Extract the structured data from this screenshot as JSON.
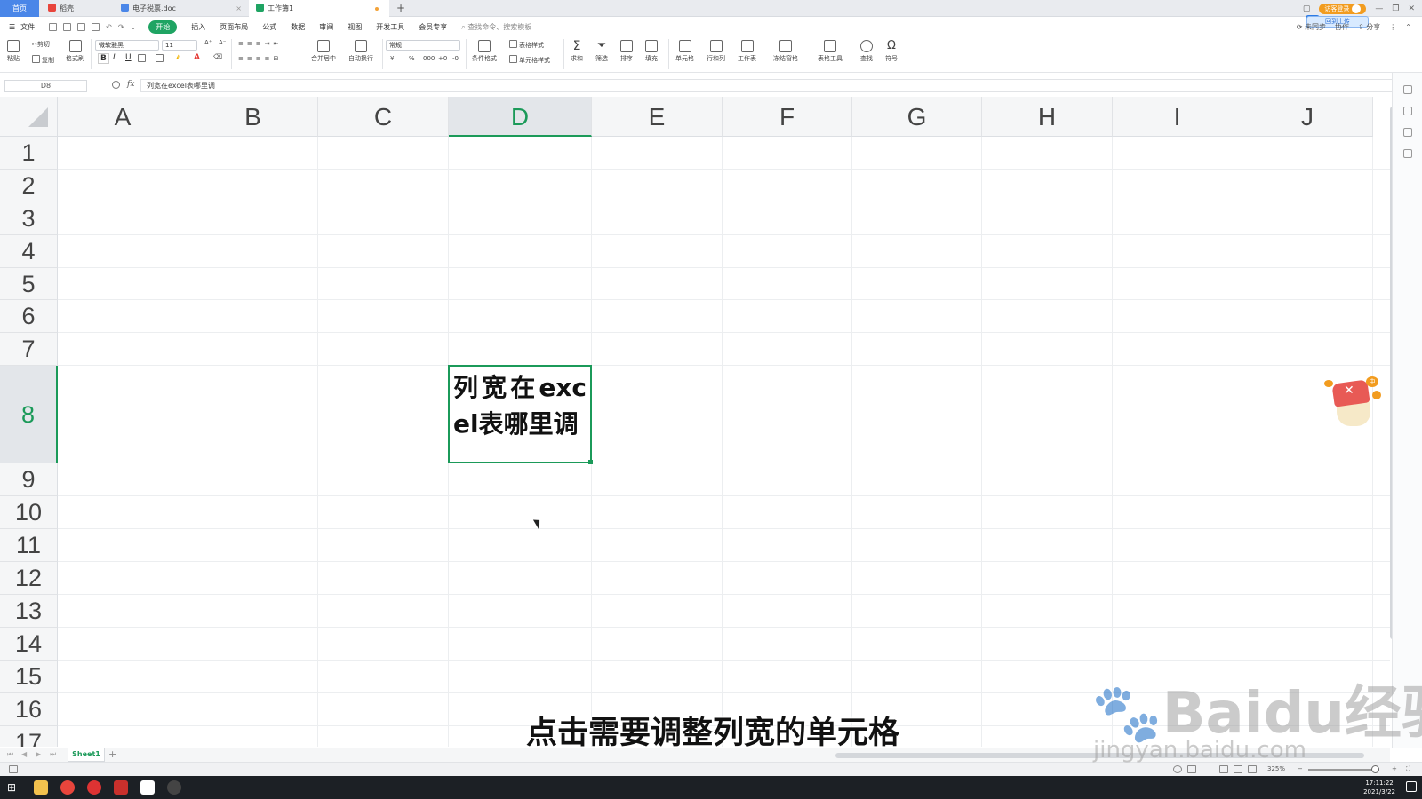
{
  "tabs": {
    "home": "首页",
    "items": [
      {
        "label": "稻壳",
        "color": "#e8453c"
      },
      {
        "label": "电子税票.doc",
        "color": "#4a86e8"
      },
      {
        "label": "工作簿1",
        "color": "#1fa463"
      }
    ],
    "add": "+",
    "login": "访客登录",
    "upload": "回到上传"
  },
  "menu": {
    "file": "文件",
    "items": [
      "开始",
      "插入",
      "页面布局",
      "公式",
      "数据",
      "审阅",
      "视图",
      "开发工具",
      "会员专享"
    ],
    "active": "开始",
    "search_placeholder": "查找命令、搜索模板",
    "right": [
      "未同步",
      "协作",
      "分享"
    ]
  },
  "ribbon": {
    "paste": "粘贴",
    "cut": "剪切",
    "copy": "复制",
    "format_painter": "格式刷",
    "font_name": "微软雅黑",
    "font_size": "11",
    "bold": "B",
    "italic": "I",
    "underline": "U",
    "merge": "合并居中",
    "wrap": "自动换行",
    "number_format": "常规",
    "currency": "¥",
    "percent": "%",
    "thousands": "000",
    "decimal_up": "+0",
    "decimal_down": "-0",
    "conditional": "条件格式",
    "table_style": "表格样式",
    "cell_style": "单元格样式",
    "sum": "求和",
    "filter": "筛选",
    "sort": "排序",
    "fill": "填充",
    "cell": "单元格",
    "rowcol": "行和列",
    "worksheet": "工作表",
    "freeze": "冻结窗格",
    "table_tools": "表格工具",
    "find": "查找",
    "symbol": "符号"
  },
  "formula_bar": {
    "name_box": "D8",
    "fx": "fx",
    "content": "列宽在excel表哪里调"
  },
  "grid": {
    "columns": [
      "A",
      "B",
      "C",
      "D",
      "E",
      "F",
      "G",
      "H",
      "I",
      "J"
    ],
    "rows": [
      "1",
      "2",
      "3",
      "4",
      "5",
      "6",
      "7",
      "8",
      "9",
      "10",
      "11",
      "12",
      "13",
      "14",
      "15",
      "16",
      "17"
    ],
    "selected_column": "D",
    "selected_row": "8",
    "cell_D8": "列宽在excel表哪里调",
    "accent": "#1b9a59"
  },
  "sheets": {
    "tabs": [
      "Sheet1"
    ],
    "add": "+"
  },
  "status": {
    "zoom": "325%"
  },
  "subtitle": "点击需要调整列宽的单元格",
  "watermark": {
    "logo": "Baidu经验",
    "url": "jingyan.baidu.com"
  },
  "taskbar": {
    "time": "17:11:22",
    "date": "2021/3/22"
  }
}
